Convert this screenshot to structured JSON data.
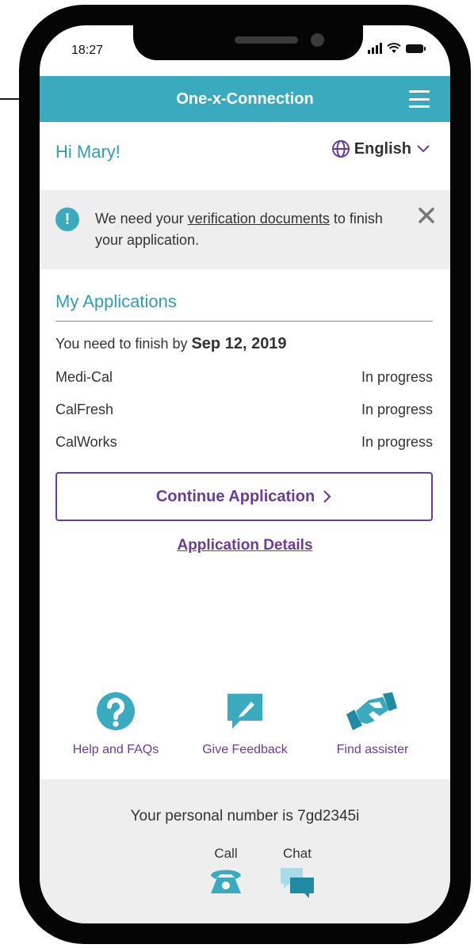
{
  "status_bar": {
    "time": "18:27"
  },
  "header": {
    "title": "One-x-Connection"
  },
  "greeting": "Hi Mary!",
  "language": {
    "selected": "English"
  },
  "alert": {
    "text_before": "We need your ",
    "link_text": "verification documents",
    "text_after": " to finish your application."
  },
  "applications": {
    "title": "My Applications",
    "deadline_prefix": "You need to finish by ",
    "deadline_date": "Sep 12, 2019",
    "items": [
      {
        "name": "Medi-Cal",
        "status": "In progress"
      },
      {
        "name": "CalFresh",
        "status": "In progress"
      },
      {
        "name": "CalWorks",
        "status": "In progress"
      }
    ],
    "continue_label": "Continue Application",
    "details_link": "Application Details"
  },
  "actions": [
    {
      "label": "Help and FAQs",
      "icon": "question-icon"
    },
    {
      "label": "Give Feedback",
      "icon": "feedback-icon"
    },
    {
      "label": "Find assister",
      "icon": "handshake-icon"
    }
  ],
  "footer": {
    "personal_number_text": "Your personal number is 7gd2345i",
    "call_label": "Call",
    "chat_label": "Chat"
  },
  "colors": {
    "teal": "#3aabbf",
    "purple": "#6b3c95",
    "gray_panel": "#eeeeee"
  }
}
